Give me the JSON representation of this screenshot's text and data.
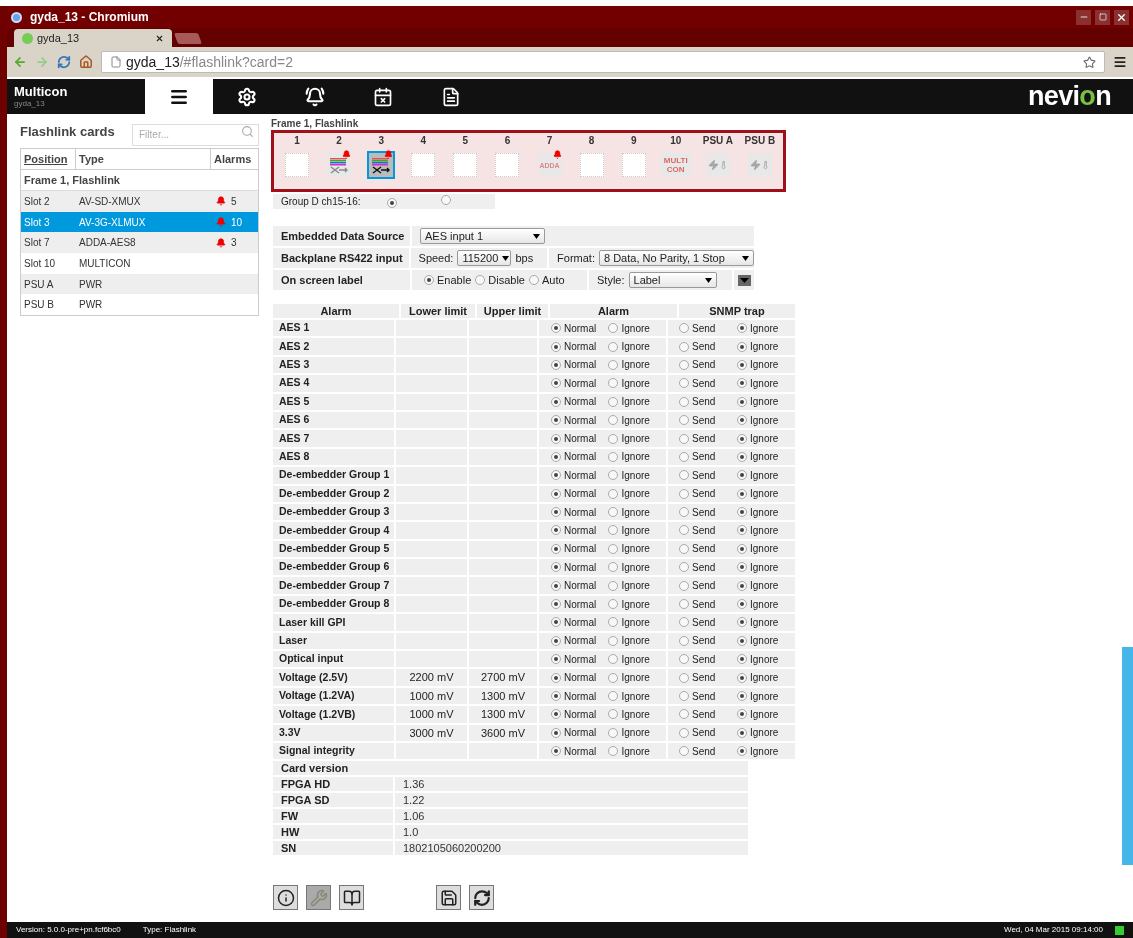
{
  "browser": {
    "title": "gyda_13 - Chromium",
    "tab_title": "gyda_13",
    "url_host": "gyda_13",
    "url_path": "/#flashlink?card=2"
  },
  "app": {
    "name": "Multicon",
    "host": "gyda_13",
    "tabs": [
      {
        "kind": "cards",
        "selected": true
      },
      {
        "kind": "settings",
        "selected": false
      },
      {
        "kind": "alarms",
        "selected": false
      },
      {
        "kind": "schedule",
        "selected": false
      },
      {
        "kind": "log",
        "selected": false
      }
    ],
    "logo": [
      {
        "text": "nevi",
        "color": "#ffffff"
      },
      {
        "text": "o",
        "color": "#7ac142"
      },
      {
        "text": "n",
        "color": "#ffffff"
      }
    ]
  },
  "sidebar": {
    "title": "Flashlink cards",
    "filter_placeholder": "Filter...",
    "columns": [
      "Position",
      "Type",
      "Alarms"
    ],
    "group": "Frame 1, Flashlink",
    "rows": [
      {
        "position": "Slot 2",
        "type": "AV-SD-XMUX",
        "alarms": "5",
        "selected": false
      },
      {
        "position": "Slot 3",
        "type": "AV-3G-XLMUX",
        "alarms": "10",
        "selected": true
      },
      {
        "position": "Slot 7",
        "type": "ADDA-AES8",
        "alarms": "3",
        "selected": false
      },
      {
        "position": "Slot 10",
        "type": "MULTICON",
        "selected": false
      },
      {
        "position": "PSU A",
        "type": "PWR",
        "selected": false
      },
      {
        "position": "PSU B",
        "type": "PWR",
        "selected": false
      }
    ]
  },
  "frame": {
    "title": "Frame 1, Flashlink",
    "slots": [
      {
        "label": "1",
        "kind": "empty",
        "selected": false
      },
      {
        "label": "2",
        "kind": "mux",
        "alarm": true,
        "selected": false
      },
      {
        "label": "3",
        "kind": "mux",
        "alarm": true,
        "selected": true
      },
      {
        "label": "4",
        "kind": "empty",
        "selected": false
      },
      {
        "label": "5",
        "kind": "empty",
        "selected": false
      },
      {
        "label": "6",
        "kind": "empty",
        "selected": false
      },
      {
        "label": "7",
        "kind": "adda",
        "alarm": true,
        "icon_text": [
          "ADDA"
        ],
        "selected": false
      },
      {
        "label": "8",
        "kind": "empty",
        "selected": false
      },
      {
        "label": "9",
        "kind": "empty",
        "selected": false
      },
      {
        "label": "10",
        "kind": "multicon",
        "icon_text": [
          "MULTI",
          "CON"
        ],
        "selected": false
      },
      {
        "label": "PSU A",
        "kind": "psu",
        "selected": false
      },
      {
        "label": "PSU B",
        "kind": "psu",
        "selected": false
      }
    ]
  },
  "group_d": {
    "label": "Group D ch15-16:",
    "options": [
      {
        "selected": true
      },
      {
        "selected": false
      }
    ]
  },
  "settings": {
    "embedded": {
      "label": "Embedded Data Source",
      "value": "AES input 1"
    },
    "backplane": {
      "label": "Backplane RS422 input",
      "speed_label": "Speed:",
      "speed": "115200",
      "unit": "bps",
      "format_label": "Format:",
      "format": "8 Data, No Parity, 1 Stop"
    },
    "osd": {
      "label": "On screen label",
      "options": [
        {
          "label": "Enable",
          "selected": true
        },
        {
          "label": "Disable",
          "selected": false
        },
        {
          "label": "Auto",
          "selected": false
        }
      ],
      "style_label": "Style:",
      "style": "Label"
    }
  },
  "alarm_table": {
    "columns": [
      "Alarm",
      "Lower limit",
      "Upper limit",
      "Alarm",
      "SNMP trap"
    ],
    "rows": [
      {
        "name": "AES 1",
        "alarm": [
          {
            "label": "Normal",
            "selected": true
          },
          {
            "label": "Ignore",
            "selected": false
          }
        ],
        "snmp": [
          {
            "label": "Send",
            "selected": false
          },
          {
            "label": "Ignore",
            "selected": true
          }
        ]
      },
      {
        "name": "AES 2",
        "alarm": [
          {
            "label": "Normal",
            "selected": true
          },
          {
            "label": "Ignore",
            "selected": false
          }
        ],
        "snmp": [
          {
            "label": "Send",
            "selected": false
          },
          {
            "label": "Ignore",
            "selected": true
          }
        ]
      },
      {
        "name": "AES 3",
        "alarm": [
          {
            "label": "Normal",
            "selected": true
          },
          {
            "label": "Ignore",
            "selected": false
          }
        ],
        "snmp": [
          {
            "label": "Send",
            "selected": false
          },
          {
            "label": "Ignore",
            "selected": true
          }
        ]
      },
      {
        "name": "AES 4",
        "alarm": [
          {
            "label": "Normal",
            "selected": true
          },
          {
            "label": "Ignore",
            "selected": false
          }
        ],
        "snmp": [
          {
            "label": "Send",
            "selected": false
          },
          {
            "label": "Ignore",
            "selected": true
          }
        ]
      },
      {
        "name": "AES 5",
        "alarm": [
          {
            "label": "Normal",
            "selected": true
          },
          {
            "label": "Ignore",
            "selected": false
          }
        ],
        "snmp": [
          {
            "label": "Send",
            "selected": false
          },
          {
            "label": "Ignore",
            "selected": true
          }
        ]
      },
      {
        "name": "AES 6",
        "alarm": [
          {
            "label": "Normal",
            "selected": true
          },
          {
            "label": "Ignore",
            "selected": false
          }
        ],
        "snmp": [
          {
            "label": "Send",
            "selected": false
          },
          {
            "label": "Ignore",
            "selected": true
          }
        ]
      },
      {
        "name": "AES 7",
        "alarm": [
          {
            "label": "Normal",
            "selected": true
          },
          {
            "label": "Ignore",
            "selected": false
          }
        ],
        "snmp": [
          {
            "label": "Send",
            "selected": false
          },
          {
            "label": "Ignore",
            "selected": true
          }
        ]
      },
      {
        "name": "AES 8",
        "alarm": [
          {
            "label": "Normal",
            "selected": true
          },
          {
            "label": "Ignore",
            "selected": false
          }
        ],
        "snmp": [
          {
            "label": "Send",
            "selected": false
          },
          {
            "label": "Ignore",
            "selected": true
          }
        ]
      },
      {
        "name": "De-embedder Group 1",
        "alarm": [
          {
            "label": "Normal",
            "selected": true
          },
          {
            "label": "Ignore",
            "selected": false
          }
        ],
        "snmp": [
          {
            "label": "Send",
            "selected": false
          },
          {
            "label": "Ignore",
            "selected": true
          }
        ]
      },
      {
        "name": "De-embedder Group 2",
        "alarm": [
          {
            "label": "Normal",
            "selected": true
          },
          {
            "label": "Ignore",
            "selected": false
          }
        ],
        "snmp": [
          {
            "label": "Send",
            "selected": false
          },
          {
            "label": "Ignore",
            "selected": true
          }
        ]
      },
      {
        "name": "De-embedder Group 3",
        "alarm": [
          {
            "label": "Normal",
            "selected": true
          },
          {
            "label": "Ignore",
            "selected": false
          }
        ],
        "snmp": [
          {
            "label": "Send",
            "selected": false
          },
          {
            "label": "Ignore",
            "selected": true
          }
        ]
      },
      {
        "name": "De-embedder Group 4",
        "alarm": [
          {
            "label": "Normal",
            "selected": true
          },
          {
            "label": "Ignore",
            "selected": false
          }
        ],
        "snmp": [
          {
            "label": "Send",
            "selected": false
          },
          {
            "label": "Ignore",
            "selected": true
          }
        ]
      },
      {
        "name": "De-embedder Group 5",
        "alarm": [
          {
            "label": "Normal",
            "selected": true
          },
          {
            "label": "Ignore",
            "selected": false
          }
        ],
        "snmp": [
          {
            "label": "Send",
            "selected": false
          },
          {
            "label": "Ignore",
            "selected": true
          }
        ]
      },
      {
        "name": "De-embedder Group 6",
        "alarm": [
          {
            "label": "Normal",
            "selected": true
          },
          {
            "label": "Ignore",
            "selected": false
          }
        ],
        "snmp": [
          {
            "label": "Send",
            "selected": false
          },
          {
            "label": "Ignore",
            "selected": true
          }
        ]
      },
      {
        "name": "De-embedder Group 7",
        "alarm": [
          {
            "label": "Normal",
            "selected": true
          },
          {
            "label": "Ignore",
            "selected": false
          }
        ],
        "snmp": [
          {
            "label": "Send",
            "selected": false
          },
          {
            "label": "Ignore",
            "selected": true
          }
        ]
      },
      {
        "name": "De-embedder Group 8",
        "alarm": [
          {
            "label": "Normal",
            "selected": true
          },
          {
            "label": "Ignore",
            "selected": false
          }
        ],
        "snmp": [
          {
            "label": "Send",
            "selected": false
          },
          {
            "label": "Ignore",
            "selected": true
          }
        ]
      },
      {
        "name": "Laser kill GPI",
        "alarm": [
          {
            "label": "Normal",
            "selected": true
          },
          {
            "label": "Ignore",
            "selected": false
          }
        ],
        "snmp": [
          {
            "label": "Send",
            "selected": false
          },
          {
            "label": "Ignore",
            "selected": true
          }
        ]
      },
      {
        "name": "Laser",
        "alarm": [
          {
            "label": "Normal",
            "selected": true
          },
          {
            "label": "Ignore",
            "selected": false
          }
        ],
        "snmp": [
          {
            "label": "Send",
            "selected": false
          },
          {
            "label": "Ignore",
            "selected": true
          }
        ]
      },
      {
        "name": "Optical input",
        "alarm": [
          {
            "label": "Normal",
            "selected": true
          },
          {
            "label": "Ignore",
            "selected": false
          }
        ],
        "snmp": [
          {
            "label": "Send",
            "selected": false
          },
          {
            "label": "Ignore",
            "selected": true
          }
        ]
      },
      {
        "name": "Voltage (2.5V)",
        "lower": "2200 mV",
        "upper": "2700 mV",
        "alarm": [
          {
            "label": "Normal",
            "selected": true
          },
          {
            "label": "Ignore",
            "selected": false
          }
        ],
        "snmp": [
          {
            "label": "Send",
            "selected": false
          },
          {
            "label": "Ignore",
            "selected": true
          }
        ]
      },
      {
        "name": "Voltage (1.2VA)",
        "lower": "1000 mV",
        "upper": "1300 mV",
        "alarm": [
          {
            "label": "Normal",
            "selected": true
          },
          {
            "label": "Ignore",
            "selected": false
          }
        ],
        "snmp": [
          {
            "label": "Send",
            "selected": false
          },
          {
            "label": "Ignore",
            "selected": true
          }
        ]
      },
      {
        "name": "Voltage (1.2VB)",
        "lower": "1000 mV",
        "upper": "1300 mV",
        "alarm": [
          {
            "label": "Normal",
            "selected": true
          },
          {
            "label": "Ignore",
            "selected": false
          }
        ],
        "snmp": [
          {
            "label": "Send",
            "selected": false
          },
          {
            "label": "Ignore",
            "selected": true
          }
        ]
      },
      {
        "name": "3.3V",
        "lower": "3000 mV",
        "upper": "3600 mV",
        "alarm": [
          {
            "label": "Normal",
            "selected": true
          },
          {
            "label": "Ignore",
            "selected": false
          }
        ],
        "snmp": [
          {
            "label": "Send",
            "selected": false
          },
          {
            "label": "Ignore",
            "selected": true
          }
        ]
      },
      {
        "name": "Signal integrity",
        "alarm": [
          {
            "label": "Normal",
            "selected": true
          },
          {
            "label": "Ignore",
            "selected": false
          }
        ],
        "snmp": [
          {
            "label": "Send",
            "selected": false
          },
          {
            "label": "Ignore",
            "selected": true
          }
        ]
      }
    ]
  },
  "card_version": {
    "title": "Card version",
    "rows": [
      {
        "label": "FPGA HD",
        "value": "1.36"
      },
      {
        "label": "FPGA SD",
        "value": "1.22"
      },
      {
        "label": "FW",
        "value": "1.06"
      },
      {
        "label": "HW",
        "value": "1.0"
      },
      {
        "label": "SN",
        "value": "1802105060200200"
      }
    ]
  },
  "toolbar": [
    {
      "kind": "info",
      "selected": false
    },
    {
      "kind": "wrench",
      "selected": true
    },
    {
      "kind": "book",
      "selected": false
    },
    {
      "kind": "save",
      "selected": false
    },
    {
      "kind": "refresh",
      "selected": false
    }
  ],
  "status_bar": {
    "version": "Version: 5.0.0-pre+pn.fcf6bc0",
    "type": "Type: Flashlink",
    "time": "Wed, 04 Mar 2015 09:14:00"
  }
}
